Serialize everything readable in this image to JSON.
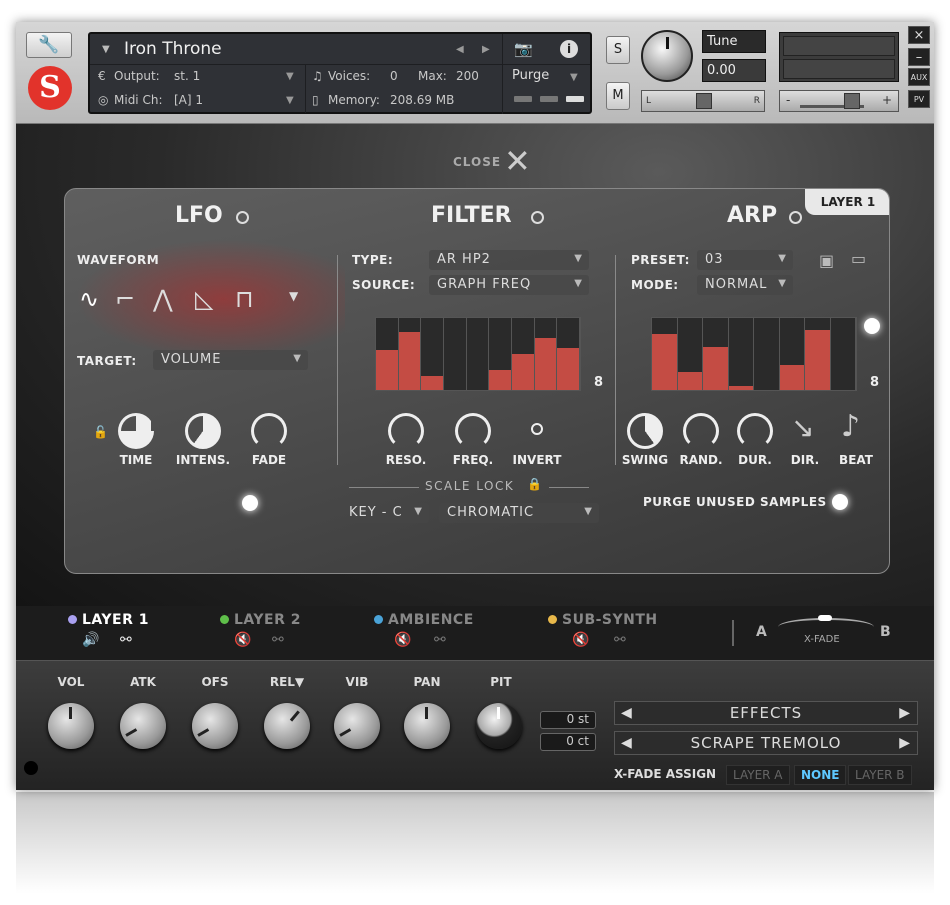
{
  "header": {
    "instrument_title": "Iron Throne",
    "output_label": "Output:",
    "output_value": "st. 1",
    "midi_label": "Midi Ch:",
    "midi_value": "[A] 1",
    "voices_label": "Voices:",
    "voices_value": "0",
    "max_label": "Max:",
    "max_value": "200",
    "memory_label": "Memory:",
    "memory_value": "208.69 MB",
    "purge_label": "Purge",
    "solo": "S",
    "mute": "M",
    "tune_label": "Tune",
    "tune_value": "0.00",
    "pan_left": "L",
    "pan_right": "R",
    "vol_minus": "-",
    "vol_plus": "+",
    "aux": "AUX",
    "pv": "PV",
    "close": "×",
    "minimize": "–"
  },
  "main": {
    "close_label": "CLOSE",
    "layer_tag": "LAYER 1",
    "lfo": {
      "title": "LFO",
      "waveform_label": "WAVEFORM",
      "target_label": "TARGET:",
      "target_value": "VOLUME",
      "knobs": [
        "TIME",
        "INTENS.",
        "FADE"
      ]
    },
    "filter": {
      "title": "FILTER",
      "type_label": "TYPE:",
      "type_value": "AR HP2",
      "source_label": "SOURCE:",
      "source_value": "GRAPH FREQ",
      "grid_count": "8",
      "knobs": [
        "RESO.",
        "FREQ.",
        "INVERT"
      ],
      "grid_values": [
        0.55,
        0.8,
        0.2,
        0,
        0,
        0.28,
        0.5,
        0.72,
        0.58
      ],
      "scale_lock": "SCALE LOCK",
      "key_value": "KEY - C",
      "scale_value": "CHROMATIC"
    },
    "arp": {
      "title": "ARP",
      "preset_label": "PRESET:",
      "preset_value": "03",
      "mode_label": "MODE:",
      "mode_value": "NORMAL",
      "grid_count": "8",
      "knobs": [
        "SWING",
        "RAND.",
        "DUR.",
        "DIR.",
        "BEAT"
      ],
      "grid_values": [
        0.78,
        0.25,
        0.6,
        0.05,
        0,
        0.35,
        0.84,
        0
      ],
      "purge_unused": "PURGE UNUSED SAMPLES"
    }
  },
  "layers": {
    "items": [
      {
        "label": "LAYER 1",
        "color": "#a9a0f0"
      },
      {
        "label": "LAYER 2",
        "color": "#5fbf4a"
      },
      {
        "label": "AMBIENCE",
        "color": "#4aa3d8"
      },
      {
        "label": "SUB-SYNTH",
        "color": "#e8b84a"
      }
    ],
    "xfade_a": "A",
    "xfade_b": "B",
    "xfade_label": "X-FADE"
  },
  "bottom": {
    "knobs": [
      "VOL",
      "ATK",
      "OFS",
      "REL▼",
      "VIB",
      "PAN",
      "PIT"
    ],
    "st_value": "0 st",
    "ct_value": "0 ct",
    "effects_label": "EFFECTS",
    "preset_label": "SCRAPE TREMOLO",
    "xfade_assign": "X-FADE ASSIGN",
    "xfade_opts": [
      "LAYER A",
      "NONE",
      "LAYER B"
    ]
  },
  "colors": {
    "accent_red": "#c44c44",
    "none_active": "#5ec8ff"
  }
}
